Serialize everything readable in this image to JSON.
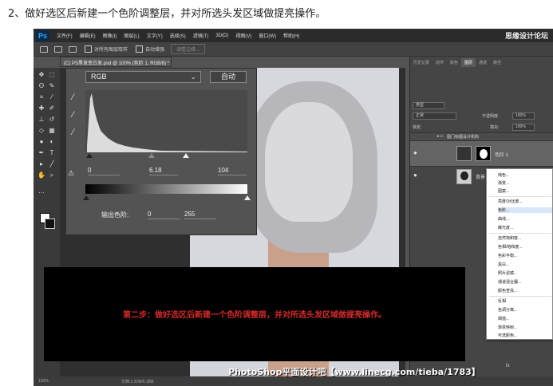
{
  "page": {
    "heading": "2、做好选区后新建一个色阶调整层，并对所选头发区域做提亮操作。"
  },
  "app": {
    "logo": "Ps",
    "menu": [
      "文件(F)",
      "编辑(E)",
      "图像(I)",
      "图层(L)",
      "文字(Y)",
      "选择(S)",
      "滤镜(T)",
      "3D(D)",
      "视图(V)",
      "窗口(W)",
      "帮助(H)"
    ],
    "brand": "思缘设计论坛"
  },
  "options": {
    "sample_all_layers": "对所有图层取样",
    "auto_enhance": "自动增强",
    "refine_edge": "调整边缘..."
  },
  "document": {
    "tab_title": "(C) PS黑发变白发.psd @ 100% (色阶 1, RGB/8) *"
  },
  "levels": {
    "channel": "RGB",
    "auto_label": "自动",
    "input_black": "0",
    "input_gamma": "6.18",
    "input_white": "104",
    "output_label": "输出色阶:",
    "output_black": "0",
    "output_white": "255"
  },
  "layers_panel": {
    "tabs": [
      "历史记录",
      "动作",
      "颜色",
      "图层",
      "通道",
      "路径"
    ],
    "kind": "类型",
    "blend_mode": "正常",
    "opacity_label": "不透明度:",
    "opacity_value": "100%",
    "lock_label": "锁定:",
    "fill_label": "填充:",
    "fill_value": "100%",
    "group_name": "图门标图设计机构",
    "layers": [
      {
        "name": "色阶 1"
      },
      {
        "name": "背景"
      }
    ]
  },
  "adjust_menu": {
    "items": [
      "纯色...",
      "渐变...",
      "图案...",
      "亮度/对比度...",
      "色阶...",
      "曲线...",
      "曝光度...",
      "自然饱和度...",
      "色相/饱和度...",
      "色彩平衡...",
      "黑白...",
      "照片滤镜...",
      "通道混合器...",
      "颜色查找...",
      "反相",
      "色调分离...",
      "阈值...",
      "渐变映射...",
      "可选颜色..."
    ]
  },
  "overlay": {
    "text": "第二步：做好选区后新建一个色阶调整层，并对所选头发区域做提亮操作。"
  },
  "status": {
    "zoom": "100%",
    "doc_size": "文档:1.31M/6.18M"
  },
  "footer": {
    "watermark": "PhotoShop平面设计吧【www.linecg.com/tieba/1783】"
  },
  "colors": {
    "ps_dark": "#2b2b2b",
    "ps_panel": "#535353",
    "overlay_text": "#d42a2a"
  }
}
